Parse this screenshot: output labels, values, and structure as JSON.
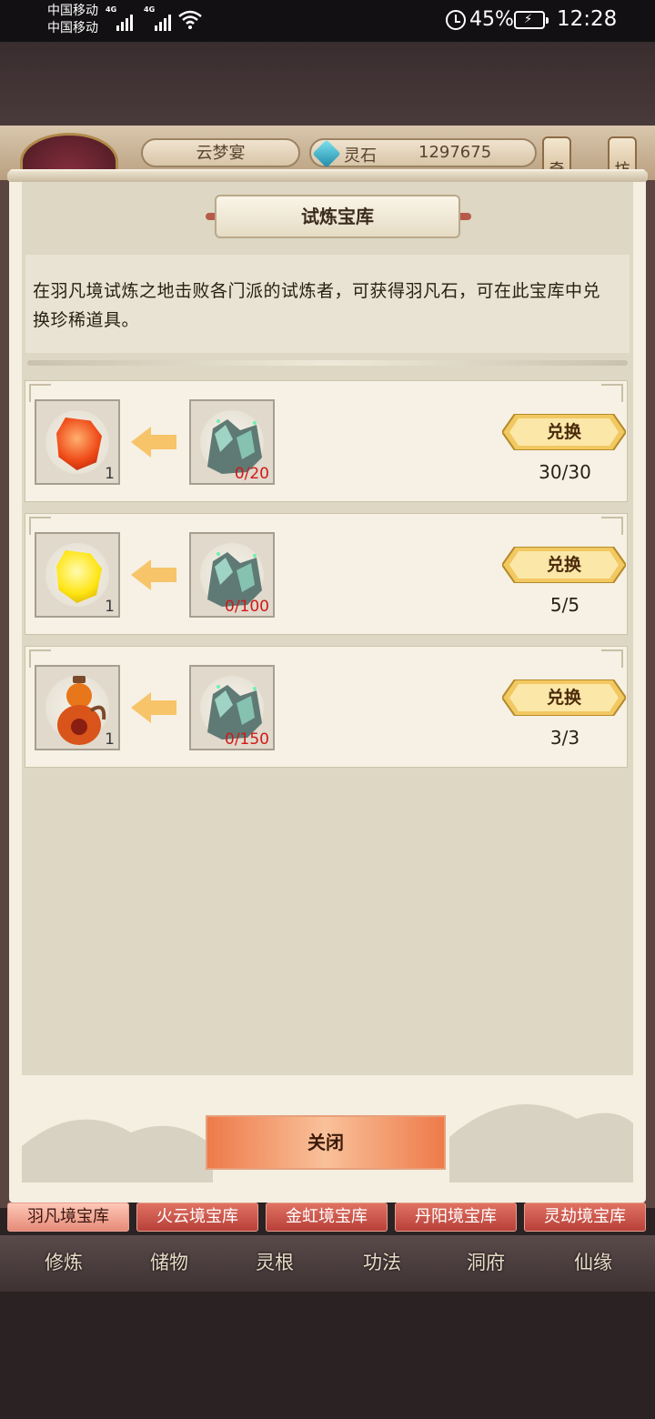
{
  "status_bar": {
    "carrier_1": "中国移动",
    "carrier_2": "中国移动",
    "network_1": "4G",
    "network_2": "4G",
    "battery_percent": "45%",
    "time": "12:28"
  },
  "header": {
    "player_name": "云梦宴",
    "currency_label": "灵石",
    "currency_value": "1297675",
    "side_button_1": "奇",
    "side_button_2": "坊"
  },
  "panel": {
    "title": "试炼宝库",
    "description": "在羽凡境试炼之地击败各门派的试炼者，可获得羽凡石，可在此宝库中兑换珍稀道具。",
    "close_label": "关闭"
  },
  "exchange_rows": [
    {
      "reward_icon": "red-gem-icon",
      "reward_count": "1",
      "cost_icon": "jade-ore-icon",
      "cost_text": "0/20",
      "button_label": "兑换",
      "limit": "30/30"
    },
    {
      "reward_icon": "yellow-gem-icon",
      "reward_count": "1",
      "cost_icon": "jade-ore-icon",
      "cost_text": "0/100",
      "button_label": "兑换",
      "limit": "5/5"
    },
    {
      "reward_icon": "gourd-icon",
      "reward_count": "1",
      "cost_icon": "jade-ore-icon",
      "cost_text": "0/150",
      "button_label": "兑换",
      "limit": "3/3"
    }
  ],
  "tabs": [
    {
      "label": "羽凡境宝库",
      "active": true
    },
    {
      "label": "火云境宝库",
      "active": false
    },
    {
      "label": "金虹境宝库",
      "active": false
    },
    {
      "label": "丹阳境宝库",
      "active": false
    },
    {
      "label": "灵劫境宝库",
      "active": false
    }
  ],
  "bottom_nav": [
    "修炼",
    "储物",
    "灵根",
    "功法",
    "洞府",
    "仙缘"
  ],
  "colors": {
    "accent_red": "#d21818",
    "tab_red": "#c54a40",
    "button_gold": "#f2c861",
    "close_orange": "#ee7a4a"
  }
}
